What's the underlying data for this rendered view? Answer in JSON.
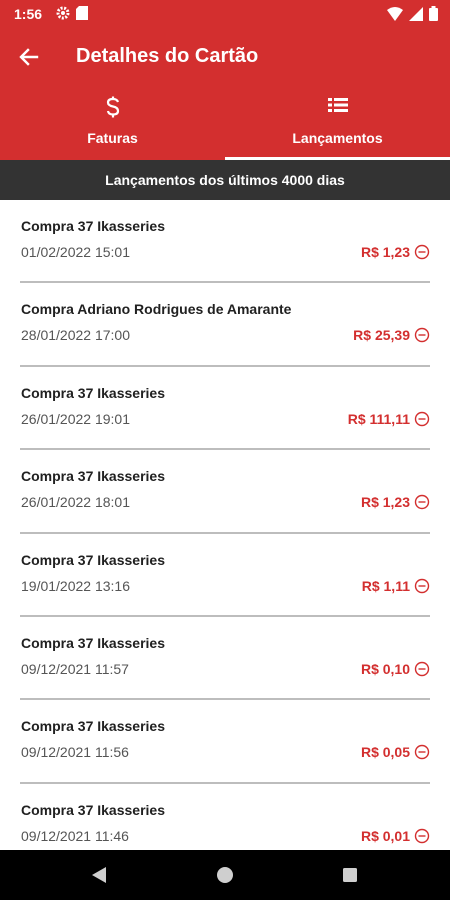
{
  "status_bar": {
    "time": "1:56"
  },
  "app_bar": {
    "title": "Detalhes do Cartão"
  },
  "tabs": [
    {
      "label": "Faturas",
      "icon": "dollar-icon"
    },
    {
      "label": "Lançamentos",
      "icon": "list-icon",
      "active": true
    }
  ],
  "subheader": "Lançamentos dos últimos 4000 dias",
  "transactions": [
    {
      "description": "Compra 37 Ikasseries",
      "datetime": "01/02/2022 15:01",
      "amount": "R$ 1,23"
    },
    {
      "description": "Compra Adriano Rodrigues de  Amarante",
      "datetime": "28/01/2022 17:00",
      "amount": "R$ 25,39"
    },
    {
      "description": "Compra 37 Ikasseries",
      "datetime": "26/01/2022 19:01",
      "amount": "R$ 111,11"
    },
    {
      "description": "Compra 37 Ikasseries",
      "datetime": "26/01/2022 18:01",
      "amount": "R$ 1,23"
    },
    {
      "description": "Compra 37 Ikasseries",
      "datetime": "19/01/2022 13:16",
      "amount": "R$ 1,11"
    },
    {
      "description": "Compra 37 Ikasseries",
      "datetime": "09/12/2021 11:57",
      "amount": "R$ 0,10"
    },
    {
      "description": "Compra 37 Ikasseries",
      "datetime": "09/12/2021 11:56",
      "amount": "R$ 0,05"
    },
    {
      "description": "Compra 37 Ikasseries",
      "datetime": "09/12/2021 11:46",
      "amount": "R$ 0,01"
    }
  ],
  "colors": {
    "primary": "#d32f2f",
    "subheader_bg": "#333333",
    "amount": "#d32f2f"
  }
}
